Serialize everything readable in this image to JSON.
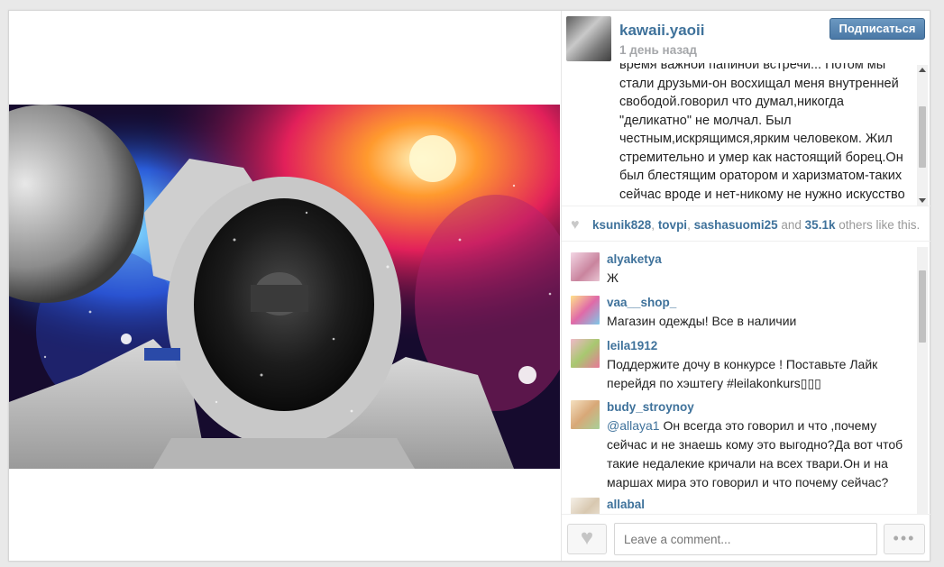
{
  "post": {
    "username": "kawaii.yaoii",
    "timestamp": "1 день назад",
    "follow_label": "Подписаться",
    "caption": "время важной папиной встречи... Потом мы стали друзьми-он восхищал меня внутренней свободой.говорил что думал,никогда \"деликатно\" не молчал. Был честным,искрящимся,ярким человеком. Жил стремительно и умер как настоящий борец.Он был блестящим оратором и харизматом-таких сейчас вроде и нет-никому не нужно искусство убеждать.все и так"
  },
  "likes": {
    "user1": "ksunik828",
    "sep1": ", ",
    "user2": "tovpi",
    "sep2": ", ",
    "user3": "sashasuomi25",
    "and": " and ",
    "count": "35.1k",
    "suffix": " others like this."
  },
  "comments": [
    {
      "user": "alyaketya",
      "text": "Ж"
    },
    {
      "user": "vaa__shop_",
      "text": "Магазин одежды! Все в наличии"
    },
    {
      "user": "leila1912",
      "text": "Поддержите дочу в конкурсе ! Поставьте Лайк перейдя по хэштегу #leilakonkurs▯▯▯"
    },
    {
      "user": "budy_stroynoy",
      "mention": "@allaya1",
      "text": " Он всегда это говорил и что ,почему сейчас и не знаешь кому это выгодно?Да вот чтоб такие недалекие кричали на всех твари.Он и на маршах мира это говорил и что почему сейчас?"
    },
    {
      "user": "allabal",
      "text": ""
    }
  ],
  "footer": {
    "comment_placeholder": "Leave a comment...",
    "more_label": "•••"
  },
  "icons": {
    "like": "heart-icon",
    "more": "ellipsis-icon"
  },
  "colors": {
    "username": "#3f729b",
    "follow_button": "#4a78a6",
    "muted": "#a5a7aa"
  }
}
